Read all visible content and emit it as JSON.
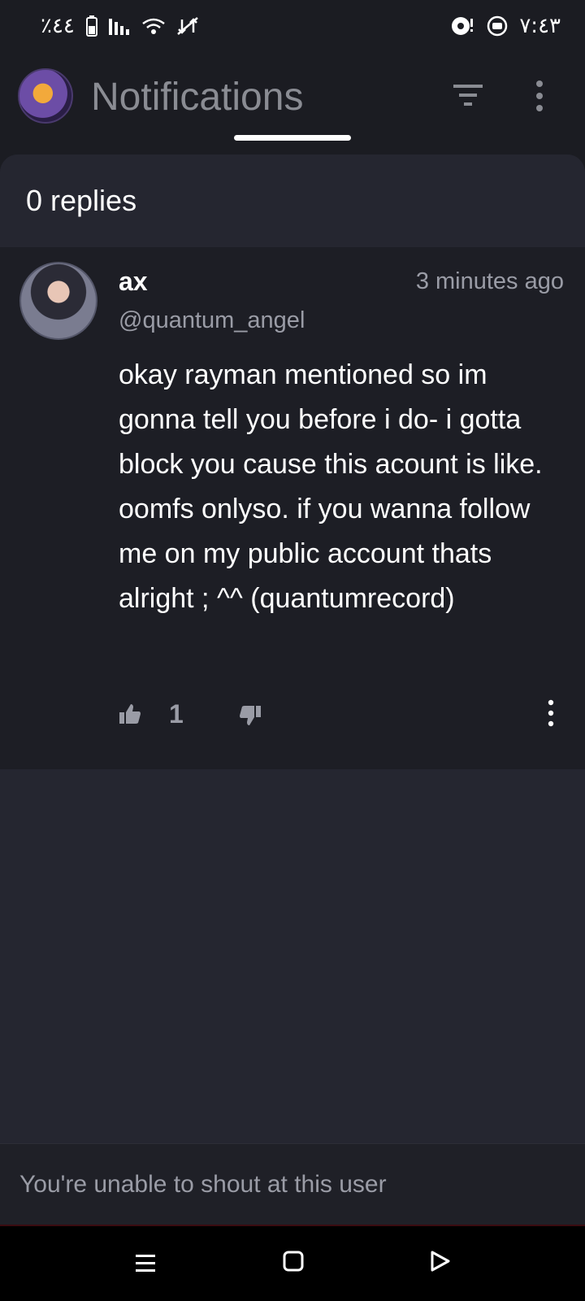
{
  "status_bar": {
    "battery_percent": "٪٤٤",
    "time": "٧:٤٣",
    "icons_left": [
      "battery-icon",
      "signal-icon",
      "wifi-icon",
      "data-off-icon"
    ],
    "icons_right": [
      "cast-icon",
      "record-icon"
    ]
  },
  "app_bar": {
    "title": "Notifications",
    "filter_icon": "filter-icon",
    "more_icon": "more-vertical-icon"
  },
  "thread": {
    "replies_label": "0 replies"
  },
  "comment": {
    "display_name": "ax",
    "handle": "@quantum_angel",
    "timestamp": "3 minutes ago",
    "body": "okay rayman mentioned so im gonna tell you before i do- i gotta block you cause this acount is like. oomfs onlyso. if you wanna follow me on my public account thats alright ; ^^ (quantumrecord)",
    "like_count": "1"
  },
  "footer": {
    "notice": "You're unable to shout at this user"
  },
  "colors": {
    "background": "#1b1c22",
    "panel": "#252630",
    "comment_bg": "#1d1e25",
    "muted_text": "#9a9ca6"
  }
}
